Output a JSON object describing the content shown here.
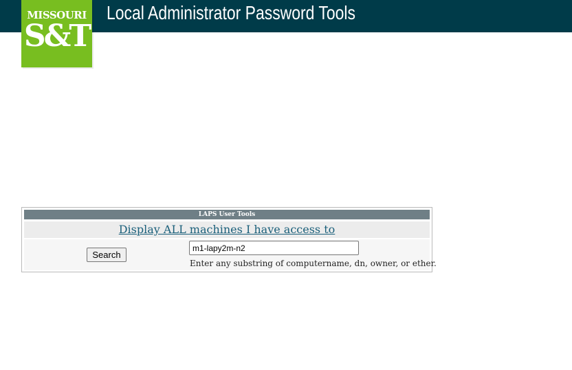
{
  "header": {
    "logo_top": "MISSOURI",
    "logo_main": "S&T",
    "title": "Local Administrator Password Tools"
  },
  "tools": {
    "title": "LAPS User Tools",
    "display_all_link": "Display ALL machines I have access to",
    "search_button": "Search",
    "search_value": "m1-lapy2m-n2",
    "hint": "Enter any substring of computername, dn, owner, or ether."
  },
  "colors": {
    "header_bg": "#003b49",
    "logo_green": "#78be20",
    "table_header_bg": "#6f7f86",
    "link": "#1a5f7a"
  }
}
